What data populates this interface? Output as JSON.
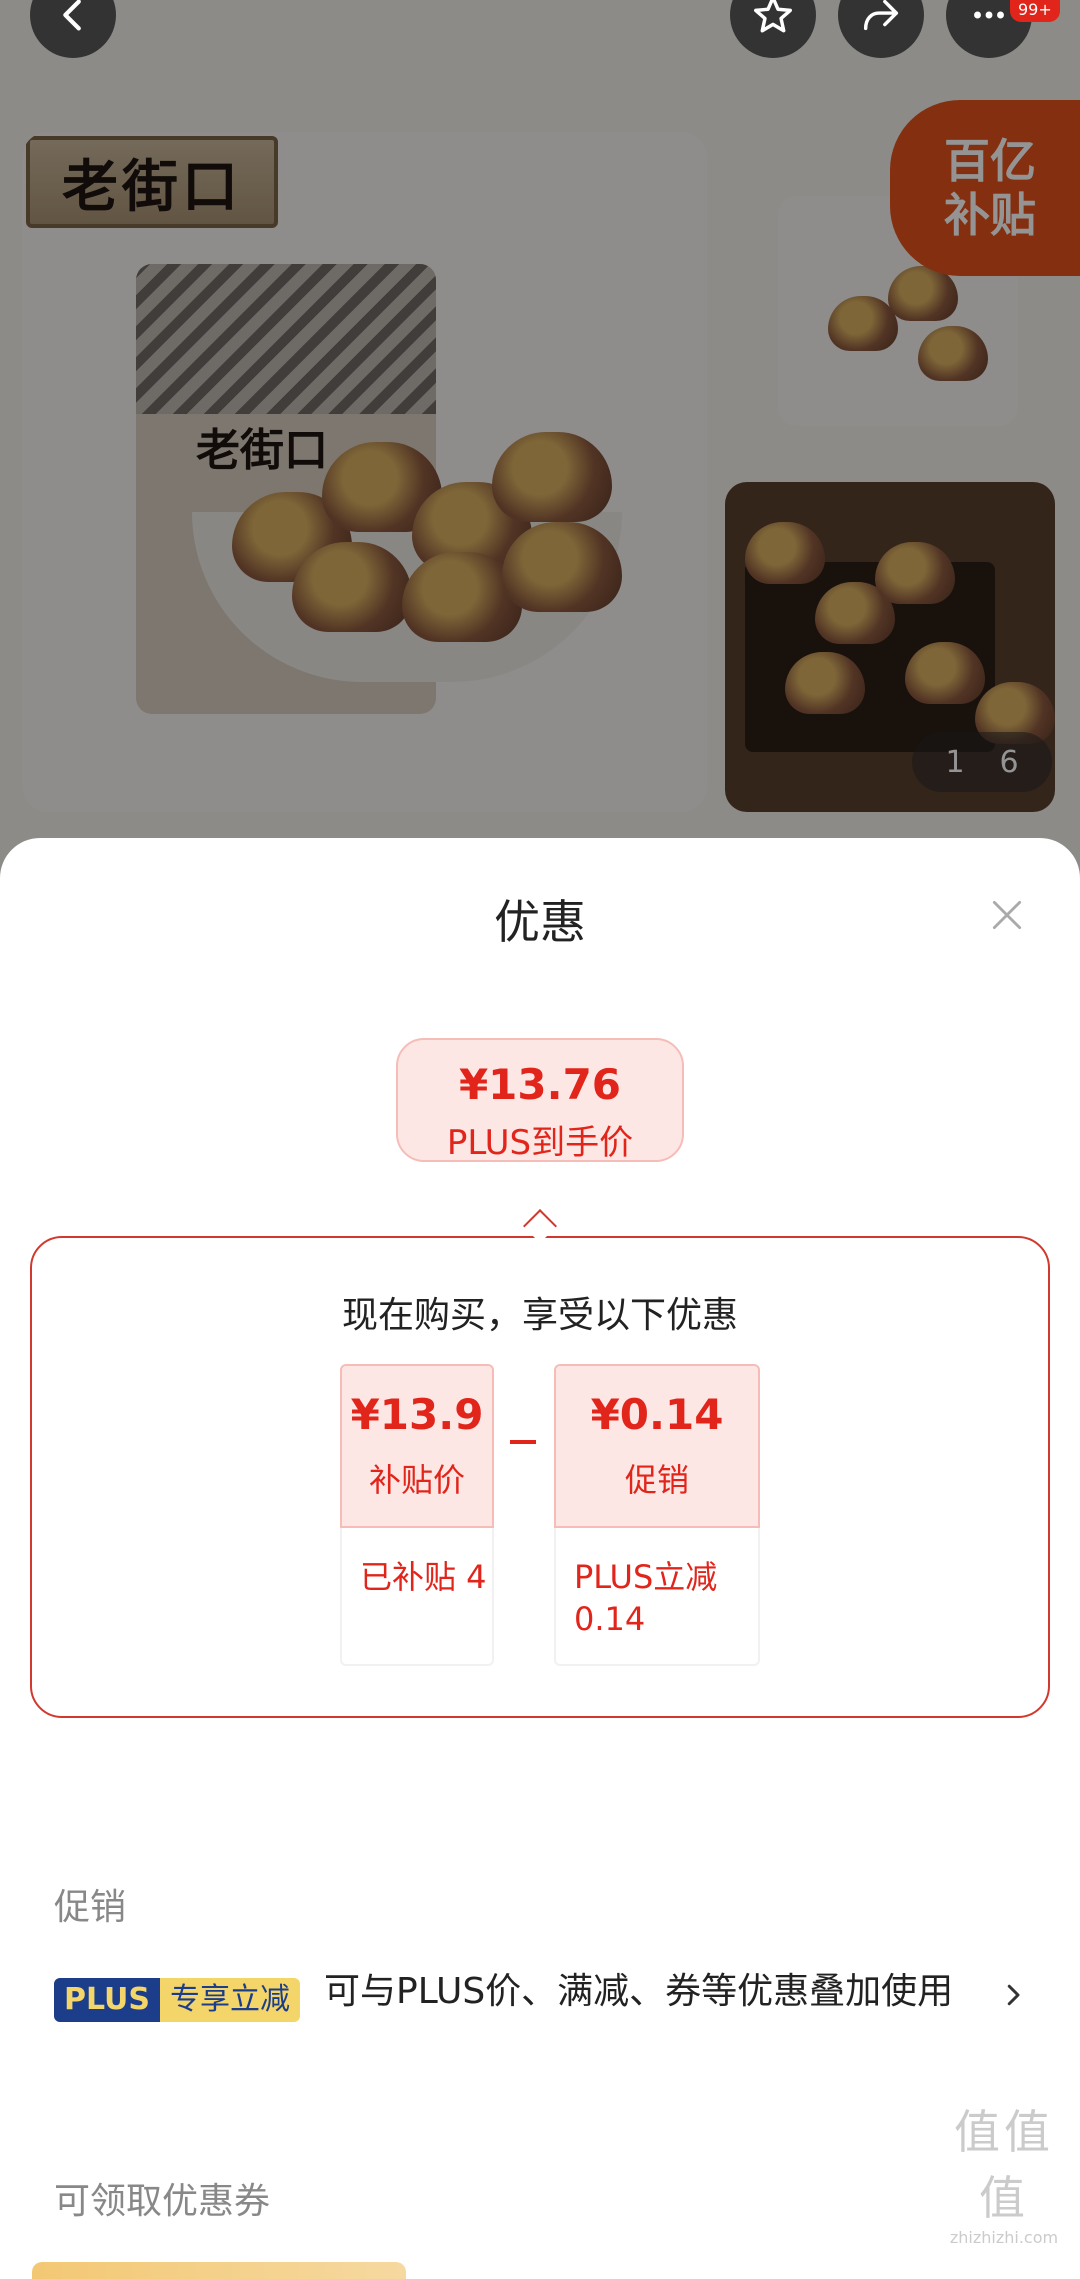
{
  "header": {
    "more_badge": "99+",
    "icons": [
      "back-icon",
      "star-icon",
      "share-icon",
      "more-icon"
    ]
  },
  "product": {
    "brand_sign": "老街口",
    "pouch_label": "老街口",
    "subsidy_badge": [
      "百亿",
      "补贴"
    ],
    "image_counter": {
      "current": "1",
      "total": "6"
    }
  },
  "sheet": {
    "title": "优惠",
    "final_price": {
      "amount": "¥13.76",
      "label": "PLUS到手价"
    },
    "breakdown": {
      "title": "现在购买，享受以下优惠",
      "items": [
        {
          "value": "¥13.9",
          "name": "补贴价",
          "detail": "已补贴 4"
        },
        {
          "value": "¥0.14",
          "name": "促销",
          "detail": "PLUS立减 0.14"
        }
      ]
    },
    "promotions": {
      "heading": "促销",
      "tag_plus": "PLUS",
      "tag_label": "专享立减",
      "text": "可与PLUS价、满减、券等优惠叠加使用"
    },
    "coupons": {
      "heading": "可领取优惠券"
    }
  },
  "watermark": {
    "title": "值值值",
    "url": "zhizhizhi.com"
  },
  "colors": {
    "accent": "#e1251b",
    "subsidy": "#e2521d",
    "plus_blue": "#1c3e8a",
    "plus_gold": "#f4d56a"
  }
}
